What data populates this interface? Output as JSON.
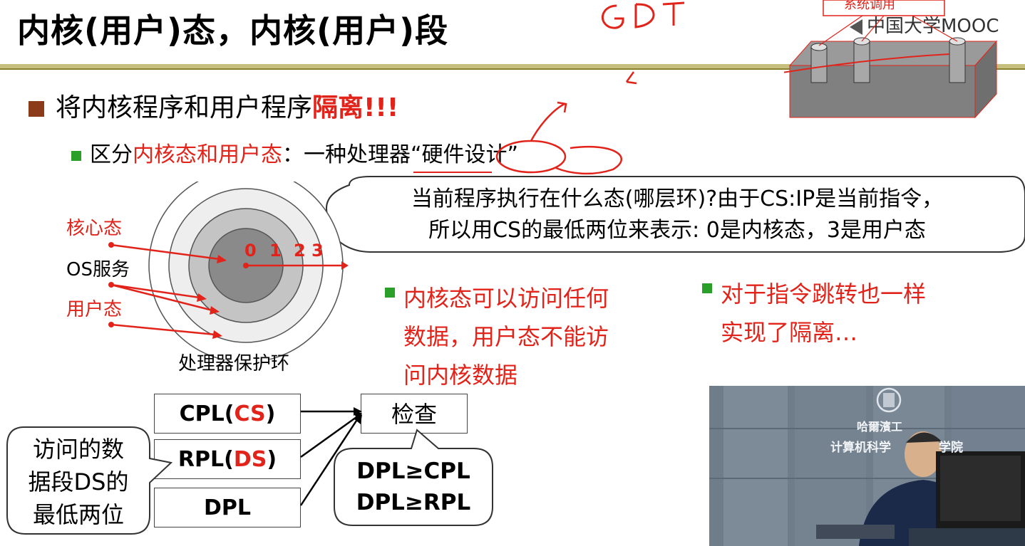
{
  "title": {
    "part1": "内核(用户)态，内核(用户)段"
  },
  "logo": {
    "text": "中国大学MOOC"
  },
  "top_diagram": {
    "label": "系统调用"
  },
  "bullet1": {
    "prefix": "将内核程序和用户程序",
    "highlight": "隔离!!!"
  },
  "bullet2": {
    "prefix": "区分",
    "highlight": "内核态和用户态",
    "suffix": "：一种处理器“硬件设计”"
  },
  "bubble": {
    "line1": "当前程序执行在什么态(哪层环)?由于CS:IP是当前指令，",
    "line2": "所以用CS的最低两位来表示: 0是内核态，3是用户态"
  },
  "rings": {
    "numbers": [
      "0",
      "1",
      "2",
      "3"
    ],
    "labels": {
      "kernel": "核心态",
      "os": "OS服务",
      "user": "用户态"
    },
    "caption": "处理器保护环",
    "colors": [
      "#eeeeee",
      "#cccccc",
      "#aaaaaa",
      "#8a8a8a"
    ]
  },
  "points": {
    "left": {
      "lines": [
        "内核态可以访问任何",
        "数据，用户态不能访",
        "问内核数据"
      ]
    },
    "right": {
      "lines": [
        "对于指令跳转也一样",
        "实现了隔离…"
      ]
    }
  },
  "privilege": {
    "cpl_prefix": "CPL(",
    "cpl_reg": "CS",
    "cpl_suffix": ")",
    "rpl_prefix": "RPL(",
    "rpl_reg": "DS",
    "rpl_suffix": ")",
    "dpl": "DPL",
    "check": "检查",
    "rule1": "DPL≥CPL",
    "rule2": "DPL≥RPL",
    "note_lines": [
      "访问的数",
      "据段DS的",
      "最低两位"
    ]
  },
  "video": {
    "sign_top": "哈爾濱工",
    "sign_bottom": "计算机科学",
    "sign_end": "学院"
  }
}
